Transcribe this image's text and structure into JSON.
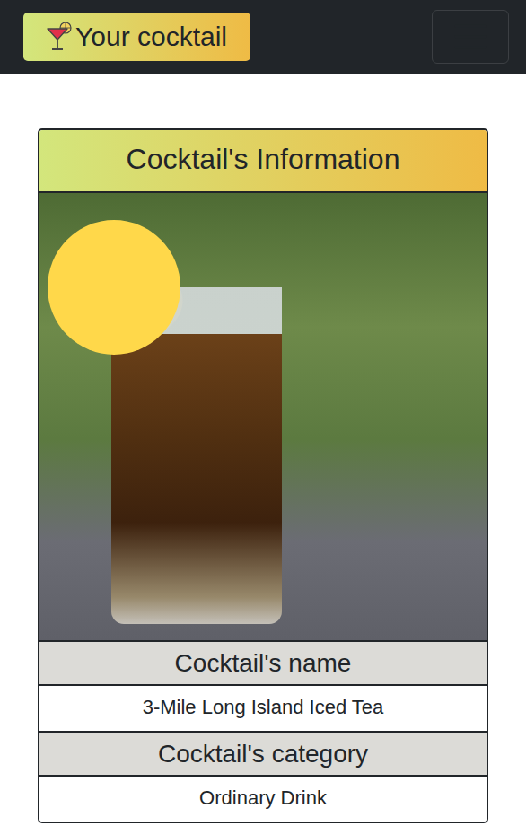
{
  "navbar": {
    "brand": "Your cocktail"
  },
  "card": {
    "title": "Cocktail's Information",
    "fields": [
      {
        "label": "Cocktail's name",
        "value": "3-Mile Long Island Iced Tea"
      },
      {
        "label": "Cocktail's category",
        "value": "Ordinary Drink"
      }
    ]
  }
}
